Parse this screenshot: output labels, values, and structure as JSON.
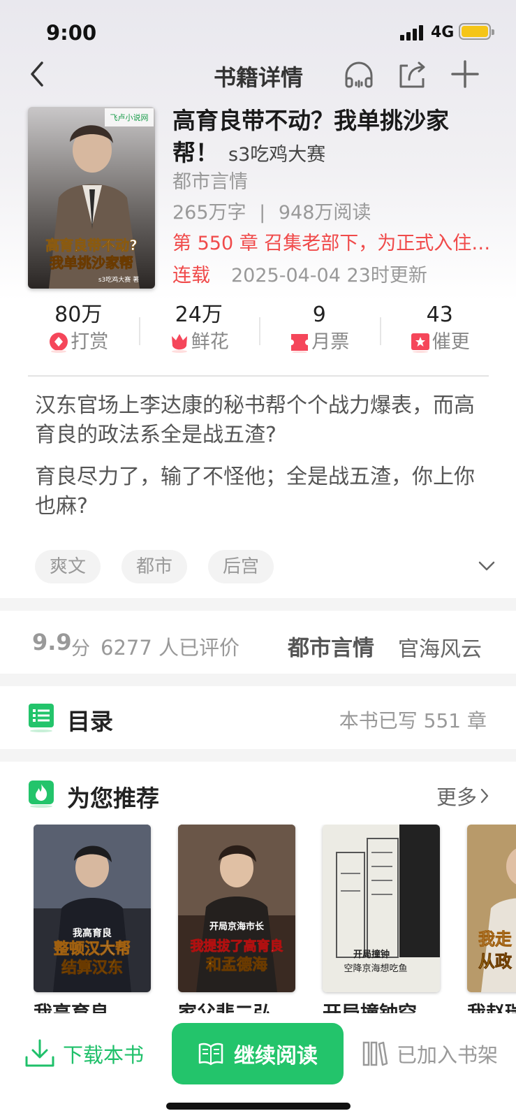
{
  "status_bar": {
    "time": "9:00",
    "network": "4G"
  },
  "nav": {
    "title": "书籍详情"
  },
  "book": {
    "title": "高育良带不动？我单挑沙家帮！",
    "author": "s3吃鸡大赛",
    "category": "都市言情",
    "word_count": "265万字",
    "separator": "|",
    "read_count": "948万阅读",
    "latest_chapter": "第 550 章 召集老部下，为正式入住…",
    "serial_status": "连载",
    "update_time": "2025-04-04 23时更新",
    "cover_text_1": "高育良带不动?",
    "cover_text_2": "我单挑沙家帮",
    "cover_publisher": "飞卢小说网",
    "cover_author": "s3吃鸡大赛 著"
  },
  "stats": [
    {
      "value": "80万",
      "label": "打赏",
      "icon": "reward-icon"
    },
    {
      "value": "24万",
      "label": "鲜花",
      "icon": "flower-icon"
    },
    {
      "value": "9",
      "label": "月票",
      "icon": "ticket-icon"
    },
    {
      "value": "43",
      "label": "催更",
      "icon": "urge-icon"
    }
  ],
  "synopsis": [
    "汉东官场上李达康的秘书帮个个战力爆表，而高育良的政法系全是战五渣?",
    "育良尽力了，输了不怪他；全是战五渣，你上你也麻?"
  ],
  "tags": [
    "爽文",
    "都市",
    "后宫"
  ],
  "rating": {
    "score": "9.9",
    "unit": "分",
    "count": "6277 人已评价",
    "category_main": "都市言情",
    "category_sub": "官海风云"
  },
  "toc": {
    "title": "目录",
    "info": "本书已写 551 章"
  },
  "recommend": {
    "title": "为您推荐",
    "more": "更多",
    "items": [
      {
        "name": "我高育良",
        "cover_line1": "我高育良",
        "cover_line2": "整顿汉大帮",
        "cover_line3": "结算汉东"
      },
      {
        "name": "家父悲二弘",
        "cover_line1": "开局京海市长",
        "cover_line2": "我提拔了高育良",
        "cover_line3": "和孟德海"
      },
      {
        "name": "开局撞钟空",
        "cover_line1": "开局撞钟",
        "cover_line2": "空降京海想吃鱼",
        "cover_line3": ""
      },
      {
        "name": "我赵瑞",
        "cover_line1": "我走",
        "cover_line2": "从政",
        "cover_line3": ""
      }
    ]
  },
  "bottom": {
    "download": "下载本书",
    "read": "继续阅读",
    "shelf": "已加入书架"
  },
  "colors": {
    "accent_green": "#23c46b",
    "alert_red": "#f04a4a"
  }
}
